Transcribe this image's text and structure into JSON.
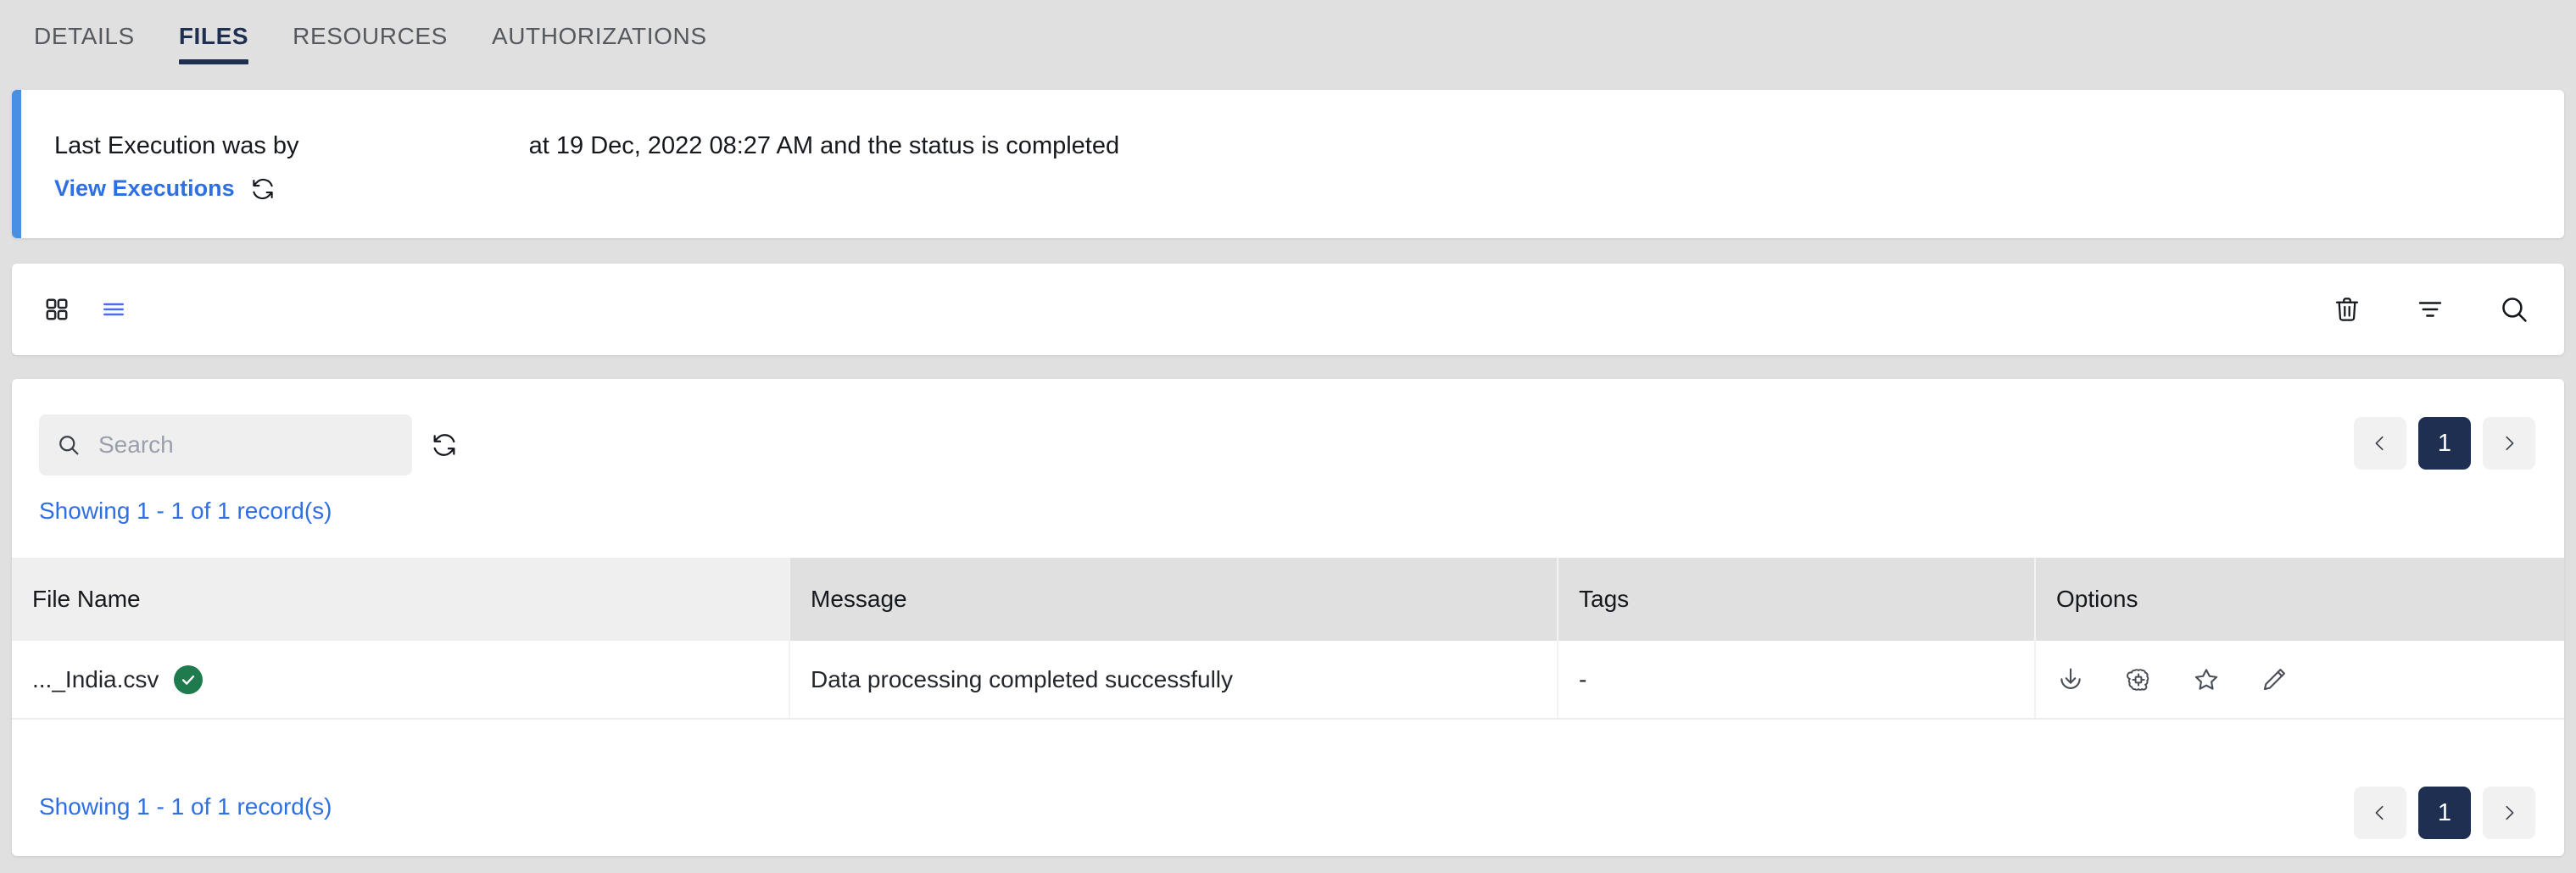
{
  "tabs": [
    {
      "label": "DETAILS",
      "active": false
    },
    {
      "label": "FILES",
      "active": true
    },
    {
      "label": "RESOURCES",
      "active": false
    },
    {
      "label": "AUTHORIZATIONS",
      "active": false
    }
  ],
  "execution_banner": {
    "prefix_text": "Last Execution was by",
    "detail_text": "at 19 Dec, 2022 08:27 AM and the status is completed",
    "view_executions_label": "View Executions",
    "refresh_icon": "refresh-icon",
    "accent_color": "#4a90e2"
  },
  "toolbar": {
    "left_icons": [
      {
        "name": "grid-view-icon",
        "state": "inactive"
      },
      {
        "name": "list-view-icon",
        "state": "active"
      }
    ],
    "right_icons": [
      {
        "name": "trash-icon"
      },
      {
        "name": "filter-icon"
      },
      {
        "name": "search-icon"
      }
    ]
  },
  "search": {
    "value": "",
    "placeholder": "Search",
    "icon": "search-icon",
    "refresh_icon": "refresh-icon"
  },
  "pagination": {
    "prev_label": "‹",
    "next_label": "›",
    "current_page": "1"
  },
  "records_summary": "Showing 1 - 1 of 1 record(s)",
  "table": {
    "columns": [
      "File Name",
      "Message",
      "Tags",
      "Options"
    ],
    "rows": [
      {
        "file_name": "..._India.csv",
        "status_badge": "success-check-icon",
        "message": "Data processing completed successfully",
        "tags": "-",
        "options": [
          {
            "name": "download-icon"
          },
          {
            "name": "brain-icon"
          },
          {
            "name": "star-icon"
          },
          {
            "name": "edit-pencil-icon"
          }
        ]
      }
    ]
  },
  "colors": {
    "page_background": "#e0e0e0",
    "card_background": "#ffffff",
    "accent_blue": "#4a90e2",
    "link_blue": "#2f6fe4",
    "navy": "#1e2f52",
    "success_green": "#1f7a4d",
    "header_gray": "#e0e0e0"
  }
}
